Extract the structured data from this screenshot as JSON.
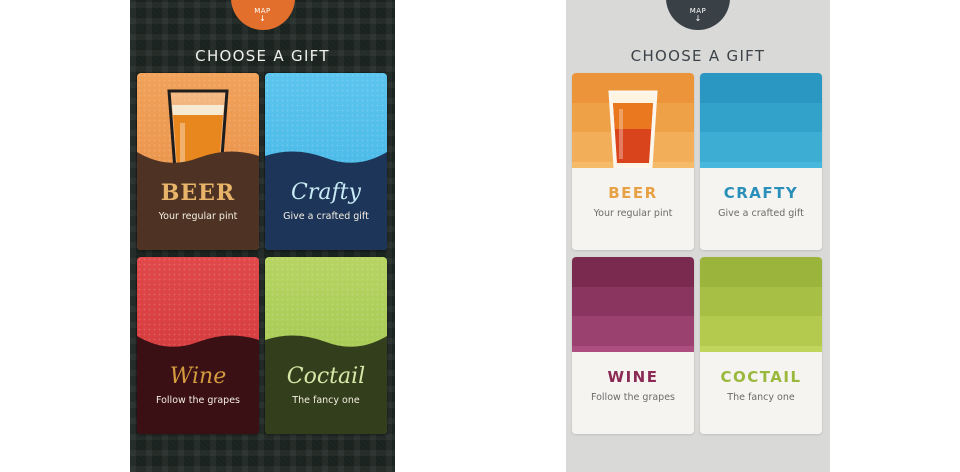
{
  "left_screen": {
    "map_tab": {
      "label": "MAP",
      "arrow": "↓"
    },
    "title": "CHOOSE A GIFT",
    "cards": [
      {
        "name": "BEER",
        "subtitle": "Your regular pint"
      },
      {
        "name": "Crafty",
        "subtitle": "Give a crafted gift"
      },
      {
        "name": "Wine",
        "subtitle": "Follow the grapes"
      },
      {
        "name": "Coctail",
        "subtitle": "The fancy one"
      }
    ]
  },
  "right_screen": {
    "map_tab": {
      "label": "MAP",
      "arrow": "↓"
    },
    "title": "CHOOSE A GIFT",
    "cards": [
      {
        "name": "BEER",
        "subtitle": "Your regular pint"
      },
      {
        "name": "CRAFTY",
        "subtitle": "Give a crafted gift"
      },
      {
        "name": "WINE",
        "subtitle": "Follow the grapes"
      },
      {
        "name": "COCTAIL",
        "subtitle": "The fancy one"
      }
    ]
  },
  "colors": {
    "left_map_tab": "#e36f2c",
    "right_map_tab": "#3a4146",
    "beer": "#e8a245",
    "crafty": "#2a8fb9",
    "wine": "#8b2a55",
    "coctail": "#9ab83c"
  },
  "icons": [
    "beer-glass-icon",
    "map-arrow-icon"
  ]
}
